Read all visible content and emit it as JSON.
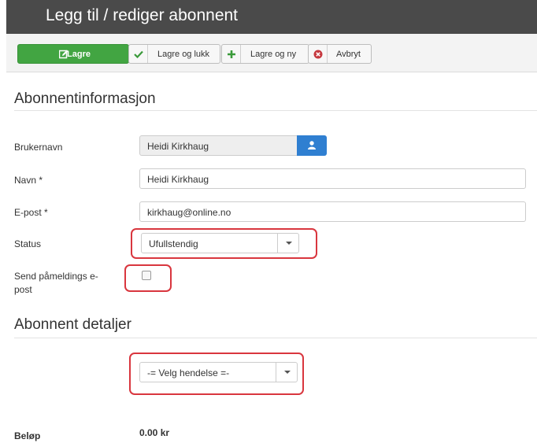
{
  "page": {
    "title": "Legg til / rediger abonnent"
  },
  "toolbar": {
    "save_label": "Lagre",
    "save_close_label": "Lagre og lukk",
    "save_new_label": "Lagre og ny",
    "cancel_label": "Avbryt"
  },
  "sections": {
    "subscriber_info": "Abonnentinformasjon",
    "subscriber_details": "Abonnent detaljer"
  },
  "form": {
    "username": {
      "label": "Brukernavn",
      "value": "Heidi Kirkhaug"
    },
    "name": {
      "label": "Navn *",
      "value": "Heidi Kirkhaug"
    },
    "email": {
      "label": "E-post *",
      "value": "kirkhaug@online.no"
    },
    "status": {
      "label": "Status",
      "value": "Ufullstendig"
    },
    "send_email": {
      "label": "Send påmeldings e-post",
      "checked": false
    },
    "event": {
      "value": "-= Velg hendelse =-"
    },
    "amount": {
      "label": "Beløp",
      "value": "0.00 kr"
    }
  },
  "icons": {
    "save": "edit-icon",
    "save_close": "check-icon",
    "save_new": "plus-icon",
    "cancel": "times-circle-icon",
    "user": "user-icon"
  },
  "colors": {
    "save_button": "#42a542",
    "user_button": "#2f7fd1",
    "highlight": "#d9363e",
    "titlebar": "#4a4a4a"
  }
}
